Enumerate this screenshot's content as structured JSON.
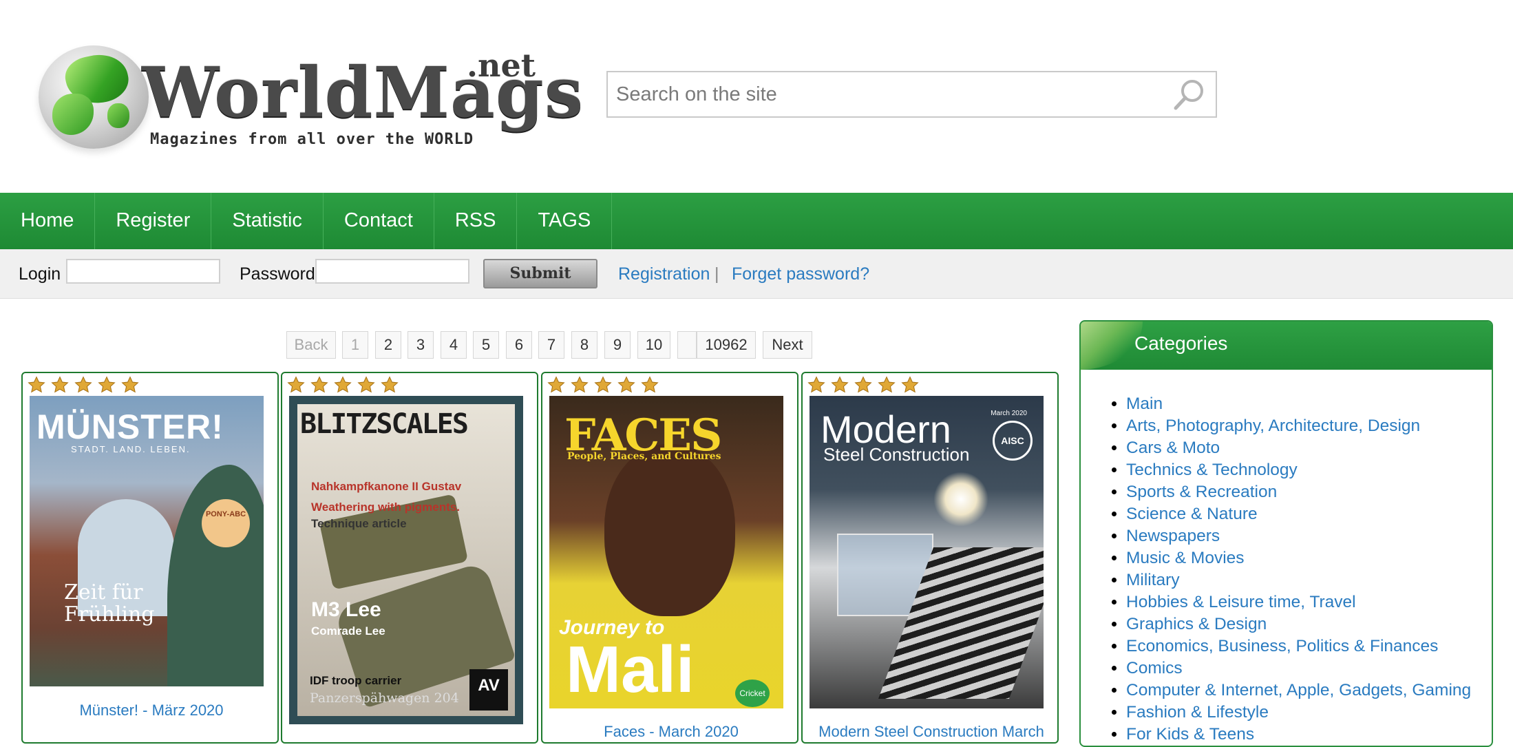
{
  "header": {
    "logo": {
      "brand": "WorldMags",
      "suffix": ".net",
      "tagline": "Magazines from all over the WORLD"
    },
    "search": {
      "placeholder": "Search on the site",
      "icon": "search-icon"
    }
  },
  "nav": {
    "items": [
      "Home",
      "Register",
      "Statistic",
      "Contact",
      "RSS",
      "TAGS"
    ]
  },
  "login": {
    "login_label": "Login",
    "password_label": "Password",
    "submit_label": "Submit",
    "registration_link": "Registration",
    "separator": "|",
    "forgot_link": "Forget password?"
  },
  "pagination": {
    "back": "Back",
    "pages": [
      "1",
      "2",
      "3",
      "4",
      "5",
      "6",
      "7",
      "8",
      "9",
      "10"
    ],
    "current": "1",
    "last": "10962",
    "next": "Next"
  },
  "magazines": [
    {
      "title": "Münster! - März 2020",
      "rating": 5,
      "cover": {
        "masthead": "MÜNSTER!",
        "subtitle": "STADT. LAND. LEBEN.",
        "badge": "PONY-ABC",
        "headline_1": "Zeit für",
        "headline_2": "Frühling"
      }
    },
    {
      "title": "",
      "rating": 5,
      "cover": {
        "masthead": "BLITZSCALES",
        "line_1": "Nahkampfkanone II Gustav",
        "line_2": "Weathering with pigments.",
        "line_3": "Technique article",
        "model": "M3 Lee",
        "model_sub": "Comrade Lee",
        "item_1": "IDF troop carrier",
        "item_2": "Panzerspähwagen 204",
        "sponsor": "AV"
      }
    },
    {
      "title": "Faces - March 2020",
      "rating": 5,
      "cover": {
        "masthead": "FACES",
        "tagline": "People, Places, and Cultures",
        "headline_1": "Journey to",
        "headline_2": "Mali",
        "badge": "Cricket"
      }
    },
    {
      "title": "Modern Steel Construction March",
      "rating": 5,
      "cover": {
        "masthead": "Modern",
        "subtitle": "Steel Construction",
        "date": "March 2020",
        "badge": "AISC"
      }
    }
  ],
  "sidebar": {
    "title": "Categories",
    "items": [
      "Main",
      "Arts, Photography, Architecture, Design",
      "Cars & Moto",
      "Technics & Technology",
      "Sports & Recreation",
      "Science & Nature",
      "Newspapers",
      "Music & Movies",
      "Military",
      "Hobbies & Leisure time, Travel",
      "Graphics & Design",
      "Economics, Business, Politics & Finances",
      "Comics",
      "Computer & Internet, Apple, Gadgets, Gaming",
      "Fashion & Lifestyle",
      "For Kids & Teens"
    ]
  },
  "colors": {
    "nav_green": "#1f8a35",
    "link_blue": "#2a7bc0",
    "card_border": "#1e7a2e",
    "star_gold": "#e0a836"
  }
}
